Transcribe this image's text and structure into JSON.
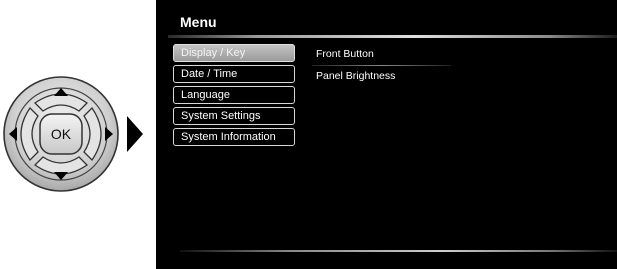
{
  "control_pad": {
    "ok_label": "OK"
  },
  "screen": {
    "title": "Menu",
    "menu_items": [
      {
        "label": "Display / Key",
        "selected": true
      },
      {
        "label": "Date / Time",
        "selected": false
      },
      {
        "label": "Language",
        "selected": false
      },
      {
        "label": "System Settings",
        "selected": false
      },
      {
        "label": "System Information",
        "selected": false
      }
    ],
    "submenu_items": [
      {
        "label": "Front Button"
      },
      {
        "label": "Panel Brightness"
      }
    ]
  },
  "colors": {
    "screen_background": "#000000",
    "selected_item": "#b0b0b0",
    "text": "#ffffff"
  },
  "icons": [
    "up-arrow-icon",
    "down-arrow-icon",
    "left-arrow-icon",
    "right-arrow-icon",
    "pointer-arrow-icon"
  ]
}
